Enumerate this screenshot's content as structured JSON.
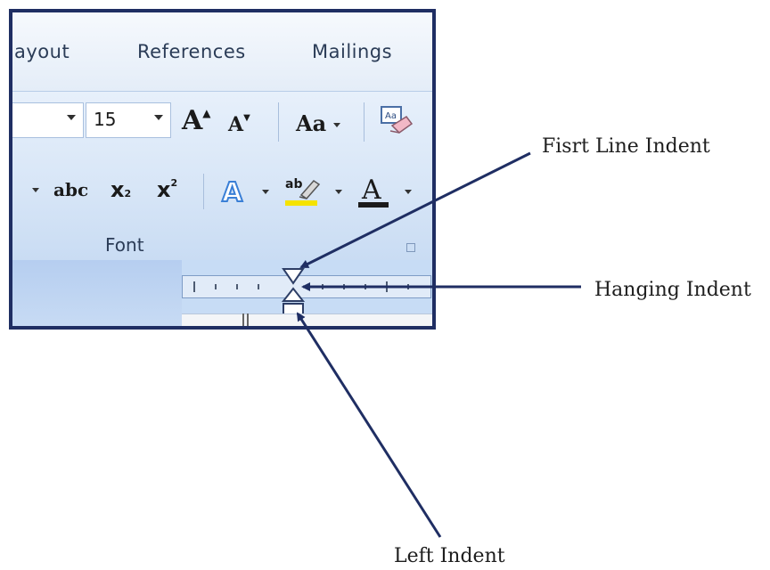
{
  "ribbon": {
    "tabs": [
      "ayout",
      "References",
      "Mailings"
    ],
    "font_size_value": "15",
    "font_group_label": "Font",
    "buttons": {
      "grow_font": "A",
      "shrink_font": "A",
      "change_case": "Aa",
      "strikethrough": "abc",
      "subscript": "x",
      "superscript": "x",
      "font_color": "A"
    },
    "colors": {
      "accent_dark": "#1f2e63",
      "highlight": "#f5e300",
      "font_color_bar": "#1b1b1b"
    }
  },
  "annotations": {
    "first_line_indent": "Fisrt Line Indent",
    "hanging_indent": "Hanging Indent",
    "left_indent": "Left Indent",
    "arrow_color": "#1f2e63"
  }
}
